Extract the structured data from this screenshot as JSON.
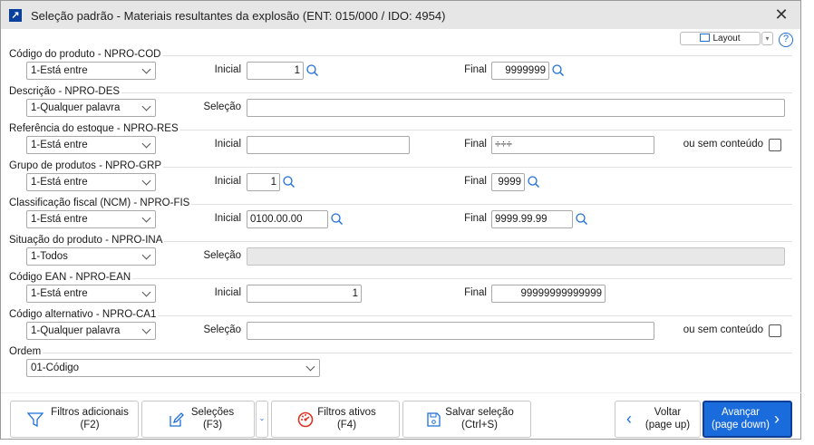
{
  "window": {
    "title": "Seleção padrão - Materiais resultantes da explosão (ENT: 015/000 / IDO: 4954)",
    "close_icon": "close-icon",
    "app_icon": "arrow-up-right-icon"
  },
  "toolbar": {
    "layout_label": "Layout",
    "help_label": "?"
  },
  "groups": [
    {
      "label": "Código do produto - NPRO-COD",
      "operator": "1-Está entre",
      "first_label": "Inicial",
      "first_value": "1",
      "second_label": "Final",
      "second_value": "9999999"
    },
    {
      "label": "Descrição - NPRO-DES",
      "operator": "1-Qualquer palavra",
      "first_label": "Seleção",
      "first_value": ""
    },
    {
      "label": "Referência do estoque - NPRO-RES",
      "operator": "1-Está entre",
      "first_label": "Inicial",
      "first_value": "",
      "second_label": "Final",
      "second_value": "÷÷÷",
      "empty_label": "ou sem conteúdo"
    },
    {
      "label": "Grupo de produtos - NPRO-GRP",
      "operator": "1-Está entre",
      "first_label": "Inicial",
      "first_value": "1",
      "second_label": "Final",
      "second_value": "9999"
    },
    {
      "label": "Classificação fiscal (NCM) - NPRO-FIS",
      "operator": "1-Está entre",
      "first_label": "Inicial",
      "first_value": "0100.00.00",
      "second_label": "Final",
      "second_value": "9999.99.99"
    },
    {
      "label": "Situação do produto - NPRO-INA",
      "operator": "1-Todos",
      "first_label": "Seleção",
      "first_value": ""
    },
    {
      "label": "Código EAN - NPRO-EAN",
      "operator": "1-Está entre",
      "first_label": "Inicial",
      "first_value": "1",
      "second_label": "Final",
      "second_value": "99999999999999"
    },
    {
      "label": "Código alternativo - NPRO-CA1",
      "operator": "1-Qualquer palavra",
      "first_label": "Seleção",
      "first_value": "",
      "empty_label": "ou sem conteúdo"
    },
    {
      "label": "Ordem",
      "operator": "01-Código"
    }
  ],
  "buttons": {
    "filtros": {
      "line1": "Filtros adicionais",
      "line2": "(F2)"
    },
    "selecoes": {
      "line1": "Seleções",
      "line2": "(F3)"
    },
    "ativos": {
      "line1": "Filtros ativos",
      "line2": "(F4)"
    },
    "salvar": {
      "line1": "Salvar seleção",
      "line2": "(Ctrl+S)"
    },
    "voltar": {
      "line1": "Voltar",
      "line2": "(page up)"
    },
    "avancar": {
      "line1": "Avançar",
      "line2": "(page down)"
    }
  },
  "colors": {
    "accent": "#1a6bdc",
    "title_bar": "#e6e6e6"
  }
}
